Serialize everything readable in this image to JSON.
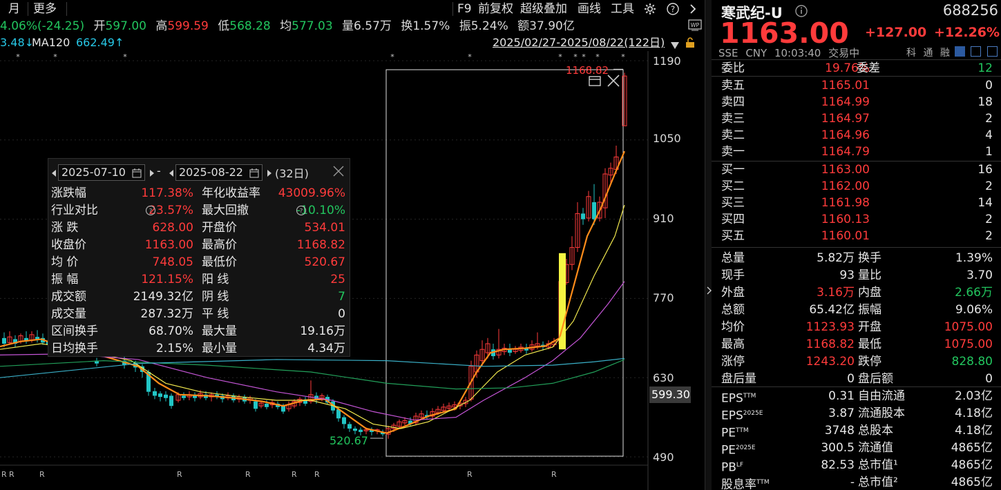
{
  "toolbar": {
    "left_items": [
      "月",
      "更多"
    ],
    "right_items": [
      "F9",
      "前复权",
      "超级叠加",
      "画线",
      "工具"
    ]
  },
  "quote_bar": {
    "change": "4.06%(-24.25)",
    "open_label": "开",
    "open": "597.00",
    "high_label": "高",
    "high": "599.59",
    "low_label": "低",
    "low": "568.28",
    "avg_label": "均",
    "avg": "577.03",
    "vol_label": "量",
    "vol": "6.57万",
    "turn_label": "换",
    "turn": "1.57%",
    "amp_label": "振",
    "amp": "5.24%",
    "amt_label": "额",
    "amt": "37.90亿"
  },
  "ma_bar": {
    "partial": "3.48↓",
    "ma120_label": "MA120",
    "ma120": "662.49↑",
    "range": "2025/02/27-2025/08/22(122日)"
  },
  "y_axis": {
    "ticks": [
      "1190",
      "1050",
      "910",
      "770",
      "630",
      "490"
    ],
    "current": "599.30"
  },
  "chart_labels": {
    "max_label": "1168.82",
    "min_label": "520.67"
  },
  "r_markers": [
    "R",
    "R",
    "R",
    "R",
    "R",
    "R",
    "R",
    "R",
    "R",
    "R",
    "R"
  ],
  "stats": {
    "date_from": "2025-07-10",
    "date_to": "2025-08-22",
    "dash": "-",
    "days": "(32日)",
    "rows": [
      {
        "l1": "涨跌幅",
        "v1": "117.38%",
        "c1": "red",
        "l2": "年化收益率",
        "v2": "43009.96%",
        "c2": "red"
      },
      {
        "l1": "行业对比",
        "v1": "23.57%",
        "c1": "red",
        "l2": "最大回撤",
        "v2": "-10.10%",
        "c2": "green"
      },
      {
        "l1": "涨 跌",
        "v1": "628.00",
        "c1": "red",
        "l2": "开盘价",
        "v2": "534.01",
        "c2": "red"
      },
      {
        "l1": "收盘价",
        "v1": "1163.00",
        "c1": "red",
        "l2": "最高价",
        "v2": "1168.82",
        "c2": "red"
      },
      {
        "l1": "均 价",
        "v1": "748.05",
        "c1": "red",
        "l2": "最低价",
        "v2": "520.67",
        "c2": "red"
      },
      {
        "l1": "振 幅",
        "v1": "121.15%",
        "c1": "red",
        "l2": "阳 线",
        "v2": "25",
        "c2": "red"
      },
      {
        "l1": "成交额",
        "v1": "2149.32亿",
        "c1": "white",
        "l2": "阴 线",
        "v2": "7",
        "c2": "green"
      },
      {
        "l1": "成交量",
        "v1": "287.32万",
        "c1": "white",
        "l2": "平 线",
        "v2": "0",
        "c2": "white"
      },
      {
        "l1": "区间换手",
        "v1": "68.70%",
        "c1": "white",
        "l2": "最大量",
        "v2": "19.16万",
        "c2": "white"
      },
      {
        "l1": "日均换手",
        "v1": "2.15%",
        "c1": "white",
        "l2": "最小量",
        "v2": "4.34万",
        "c2": "white"
      }
    ]
  },
  "stock": {
    "name": "寒武纪-U",
    "code": "688256",
    "price": "1163.00",
    "change": "+127.00",
    "pct": "+12.26%",
    "exchange": "SSE",
    "currency": "CNY",
    "time": "10:03:40",
    "status": "交易中",
    "tags": [
      "科",
      "通",
      "融"
    ]
  },
  "order_book": {
    "weibi_label": "委比",
    "weibi": "19.76%",
    "weicha_label": "委差",
    "weicha": "12",
    "asks": [
      {
        "label": "卖五",
        "price": "1165.01",
        "vol": "0"
      },
      {
        "label": "卖四",
        "price": "1164.99",
        "vol": "18"
      },
      {
        "label": "卖三",
        "price": "1164.97",
        "vol": "2"
      },
      {
        "label": "卖二",
        "price": "1164.96",
        "vol": "4"
      },
      {
        "label": "卖一",
        "price": "1164.79",
        "vol": "1"
      }
    ],
    "bids": [
      {
        "label": "买一",
        "price": "1163.00",
        "vol": "16"
      },
      {
        "label": "买二",
        "price": "1162.00",
        "vol": "2"
      },
      {
        "label": "买三",
        "price": "1161.98",
        "vol": "14"
      },
      {
        "label": "买四",
        "price": "1160.13",
        "vol": "2"
      },
      {
        "label": "买五",
        "price": "1160.01",
        "vol": "2"
      }
    ]
  },
  "details": [
    {
      "l1": "总量",
      "v1": "5.82万",
      "c1": "white",
      "l2": "换手",
      "v2": "1.39%",
      "c2": "white"
    },
    {
      "l1": "现手",
      "v1": "93",
      "c1": "white",
      "l2": "量比",
      "v2": "3.70",
      "c2": "white"
    },
    {
      "l1": "外盘",
      "v1": "3.16万",
      "c1": "red",
      "l2": "内盘",
      "v2": "2.66万",
      "c2": "green"
    },
    {
      "l1": "总额",
      "v1": "65.42亿",
      "c1": "white",
      "l2": "振幅",
      "v2": "9.06%",
      "c2": "white"
    },
    {
      "l1": "均价",
      "v1": "1123.93",
      "c1": "red",
      "l2": "开盘",
      "v2": "1075.00",
      "c2": "red"
    },
    {
      "l1": "最高",
      "v1": "1168.82",
      "c1": "red",
      "l2": "最低",
      "v2": "1075.00",
      "c2": "red"
    },
    {
      "l1": "涨停",
      "v1": "1243.20",
      "c1": "red",
      "l2": "跌停",
      "v2": "828.80",
      "c2": "green"
    },
    {
      "l1": "盘后量",
      "v1": "0",
      "c1": "white",
      "l2": "盘后额",
      "v2": "0",
      "c2": "white"
    }
  ],
  "fundamentals": [
    {
      "l1": "EPS",
      "s1": "TTM",
      "v1": "0.31",
      "l2": "自由流通",
      "v2": "2.03亿"
    },
    {
      "l1": "EPS",
      "s1": "2025E",
      "v1": "3.87",
      "l2": "流通股本",
      "v2": "4.18亿"
    },
    {
      "l1": "PE",
      "s1": "TTM",
      "v1": "3748",
      "l2": "总股本",
      "v2": "4.18亿"
    },
    {
      "l1": "PE",
      "s1": "2025E",
      "v1": "300.5",
      "l2": "流通值",
      "v2": "4865亿"
    },
    {
      "l1": "PB",
      "s1": "LF",
      "v1": "82.53",
      "l2": "总市值¹",
      "v2": "4865亿"
    },
    {
      "l1": "股息率",
      "s1": "TTM",
      "v1": "-",
      "l2": "总市值²",
      "v2": "4865亿"
    }
  ],
  "colors": {
    "up": "#ff3b3b",
    "down": "#22c5c5",
    "ma5": "#ff8c1a",
    "ma10": "#f2e94e",
    "ma20": "#c455d6",
    "ma60": "#22a05a",
    "ma120": "#3ab0c8",
    "highlight": "#f5f542"
  }
}
